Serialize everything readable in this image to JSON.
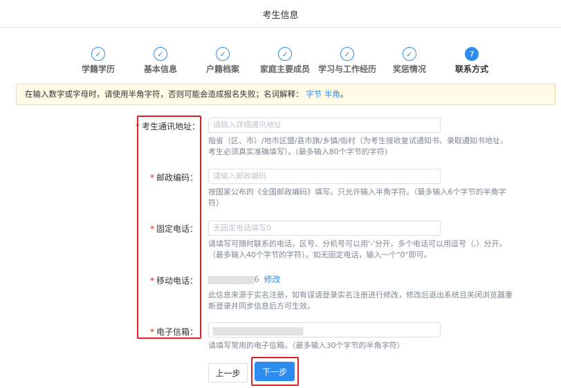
{
  "header": {
    "title": "考生信息"
  },
  "steps": [
    {
      "label": "学籍学历",
      "icon": "check-icon",
      "symbol": "✓",
      "active": false
    },
    {
      "label": "基本信息",
      "icon": "check-icon",
      "symbol": "✓",
      "active": false
    },
    {
      "label": "户籍档案",
      "icon": "check-icon",
      "symbol": "✓",
      "active": false
    },
    {
      "label": "家庭主要成员",
      "icon": "check-icon",
      "symbol": "✓",
      "active": false
    },
    {
      "label": "学习与工作经历",
      "icon": "check-icon",
      "symbol": "✓",
      "active": false
    },
    {
      "label": "奖惩情况",
      "icon": "check-icon",
      "symbol": "✓",
      "active": false
    },
    {
      "label": "联系方式",
      "icon": "step-number-icon",
      "symbol": "7",
      "active": true
    }
  ],
  "notice": {
    "text": "在输入数字或字母时，请使用半角字符，否则可能会造成报名失败；名词解释：",
    "link1": "字节",
    "link2": "半角",
    "end": "。"
  },
  "form": {
    "required_mark": "*",
    "address": {
      "label": "考生通讯地址：",
      "placeholder": "请输入详细通讯地址",
      "hint": "指省（区、市）/地市区盟/县市旗/乡镇/街村（为考生接收复试通知书、录取通知书地址，考生必须真实准确填写）。(最多输入80个字节的字符)"
    },
    "postal": {
      "label": "邮政编码：",
      "placeholder": "请输入邮政编码",
      "hint": "按国家公布的《全国邮政编码》填写。只允许输入半角字符。（最多输入6个字节的半角字符）"
    },
    "phone": {
      "label": "固定电话：",
      "placeholder": "无固定电话填写0",
      "hint": "请填写可随时联系的电话，区号、分机号可以用'-'分开，多个电话可以用逗号（,）分开。（最多输入40个字节的字符）。如无固定电话，输入一个\"0\"即可。"
    },
    "mobile": {
      "label": "移动电话：",
      "value_suffix": "6",
      "edit_link": "修改",
      "hint": "此信息来源于实名注册，如有误请登录实名注册进行修改，修改后退出系统且关闭浏览器重新登录并同步信息后方可生效。"
    },
    "email": {
      "label": "电子信箱：",
      "hint": "请填写常用的电子信箱。（最多输入30个字节的半角字符）"
    }
  },
  "buttons": {
    "prev": "上一步",
    "next": "下一步"
  },
  "colors": {
    "accent": "#2d8cf0",
    "highlight": "#e02020",
    "notice_bg": "#fffbe6"
  }
}
